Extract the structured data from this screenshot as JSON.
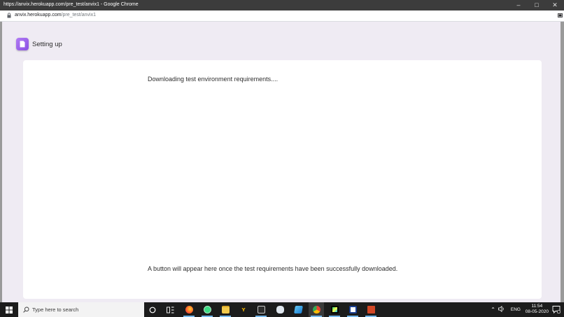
{
  "window": {
    "title": "https://anvix.herokuapp.com/pre_test/anvix1 - Google Chrome",
    "controls": [
      "minimize-icon",
      "maximize-icon",
      "close-icon"
    ]
  },
  "address_bar": {
    "host": "anvix.herokuapp.com",
    "path": "/pre_test/anvix1"
  },
  "page": {
    "header_title": "Setting up",
    "status": "Downloading test environment requirements....",
    "footer_note": "A button will appear here once the test requirements have been successfully downloaded."
  },
  "taskbar": {
    "search_placeholder": "Type here to search",
    "apps": [
      "cortana",
      "task-view",
      "firefox",
      "android-studio",
      "file-explorer",
      "app-y",
      "terminal",
      "app-cloud",
      "app-blue",
      "chrome",
      "pycharm",
      "app-dark",
      "powerpoint"
    ],
    "tray": {
      "language": "ENG",
      "time": "11:54",
      "date": "08-05-2020"
    }
  },
  "colors": {
    "page_bg": "#efebf3",
    "accent": "#8a4fe3",
    "taskbar": "#1c1c1c"
  }
}
